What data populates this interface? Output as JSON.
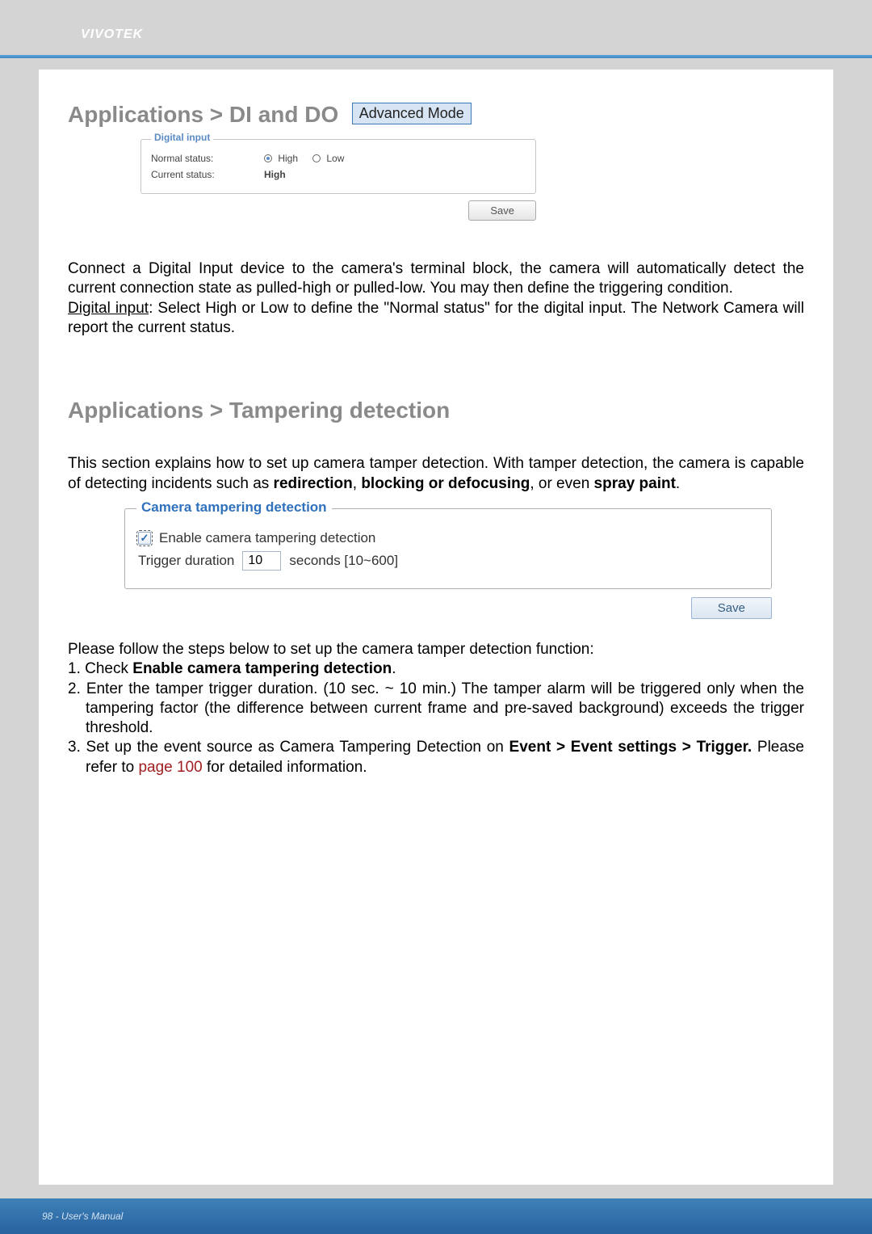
{
  "header": {
    "brand": "VIVOTEK"
  },
  "section_dido": {
    "title": "Applications > DI and DO",
    "badge": "Advanced Mode",
    "fieldset_legend": "Digital input",
    "rows": {
      "normal_label": "Normal status:",
      "normal_options": {
        "high": "High",
        "low": "Low"
      },
      "normal_selected": "high",
      "current_label": "Current status:",
      "current_value": "High"
    },
    "save_button": "Save"
  },
  "dido_para": {
    "p1": "Connect a Digital Input device to the camera's terminal block, the camera will automatically detect the current connection state as pulled-high or pulled-low. You may then define the triggering condition.",
    "p2_underline": "Digital input",
    "p2_rest": ": Select High or Low to define the \"Normal status\" for the digital input. The Network Camera will report the current status."
  },
  "section_tamper": {
    "title": "Applications > Tampering detection",
    "intro_a": "This section explains how to set up camera tamper detection. With tamper detection, the camera is capable of detecting incidents such as ",
    "intro_b_bold": "redirection",
    "intro_c": ", ",
    "intro_d_bold": "blocking or defocusing",
    "intro_e": ", or even ",
    "intro_f_bold": "spray paint",
    "intro_g": ".",
    "legend": "Camera tampering detection",
    "enable_label": "Enable camera tampering detection",
    "enable_checked": true,
    "trigger_label": "Trigger duration",
    "trigger_value": "10",
    "trigger_suffix": "seconds [10~600]",
    "save_button": "Save"
  },
  "steps": {
    "intro": "Please follow the steps below to set up the camera tamper detection function:",
    "s1_a": "1. Check ",
    "s1_b_bold": "Enable camera tampering detection",
    "s1_c": ".",
    "s2": "2. Enter the tamper trigger duration. (10 sec. ~ 10 min.) The tamper alarm will be triggered only when the tampering factor (the difference between current frame and pre-saved background) exceeds the trigger threshold.",
    "s3_a": "3. Set up the event source as Camera Tampering Detection on ",
    "s3_b_bold": "Event > Event settings > Trigger.",
    "s3_c": " Please refer to ",
    "s3_d_red": "page 100",
    "s3_e": " for detailed information."
  },
  "footer": {
    "text": "98 - User's Manual"
  }
}
